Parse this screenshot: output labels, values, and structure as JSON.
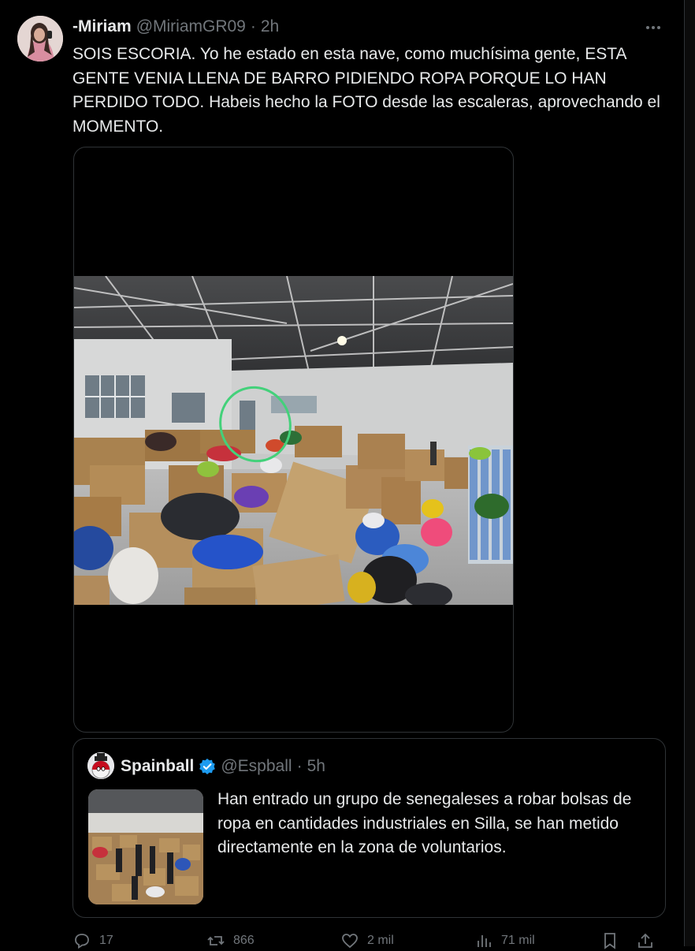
{
  "post": {
    "author_name": "-Miriam",
    "author_handle": "@MiriamGR09",
    "separator": "·",
    "time": "2h",
    "text": "SOIS ESCORIA. Yo he estado en esta nave, como muchísima gente, ESTA GENTE VENIA LLENA DE BARRO PIDIENDO ROPA PORQUE LO HAN PERDIDO TODO. Habeis hecho la FOTO desde las escaleras, aprovechando el MOMENTO."
  },
  "quote": {
    "author_name": "Spainball",
    "author_handle": "@Espball",
    "separator": "·",
    "time": "5h",
    "text": "Han entrado un grupo de senegaleses a robar bolsas de ropa en cantidades industriales en Silla, se han metido directamente en la zona de voluntarios."
  },
  "actions": {
    "replies": "17",
    "reposts": "866",
    "likes": "2 mil",
    "views": "71 mil"
  },
  "icons": {
    "more": "more-icon",
    "verified": "verified-badge-icon",
    "reply": "reply-icon",
    "repost": "repost-icon",
    "like": "like-icon",
    "views": "views-icon",
    "bookmark": "bookmark-icon",
    "share": "share-icon"
  },
  "colors": {
    "background": "#000000",
    "text": "#e7e9ea",
    "secondary": "#71767b",
    "border": "#2f3336",
    "verified": "#1d9bf0",
    "highlight_circle": "#43d17a"
  }
}
